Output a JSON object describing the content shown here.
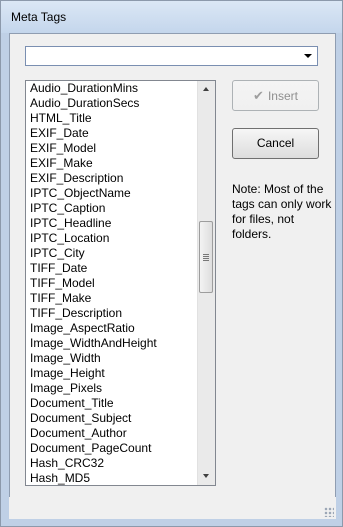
{
  "window": {
    "title": "Meta Tags"
  },
  "combo": {
    "value": ""
  },
  "list": {
    "items": [
      "Audio_DurationMins",
      "Audio_DurationSecs",
      "HTML_Title",
      "EXIF_Date",
      "EXIF_Model",
      "EXIF_Make",
      "EXIF_Description",
      "IPTC_ObjectName",
      "IPTC_Caption",
      "IPTC_Headline",
      "IPTC_Location",
      "IPTC_City",
      "TIFF_Date",
      "TIFF_Model",
      "TIFF_Make",
      "TIFF_Description",
      "Image_AspectRatio",
      "Image_WidthAndHeight",
      "Image_Width",
      "Image_Height",
      "Image_Pixels",
      "Document_Title",
      "Document_Subject",
      "Document_Author",
      "Document_PageCount",
      "Hash_CRC32",
      "Hash_MD5"
    ]
  },
  "buttons": {
    "insert_label": "Insert",
    "cancel_label": "Cancel"
  },
  "note": {
    "text": "Note: Most of the tags can only work for files, not folders."
  }
}
